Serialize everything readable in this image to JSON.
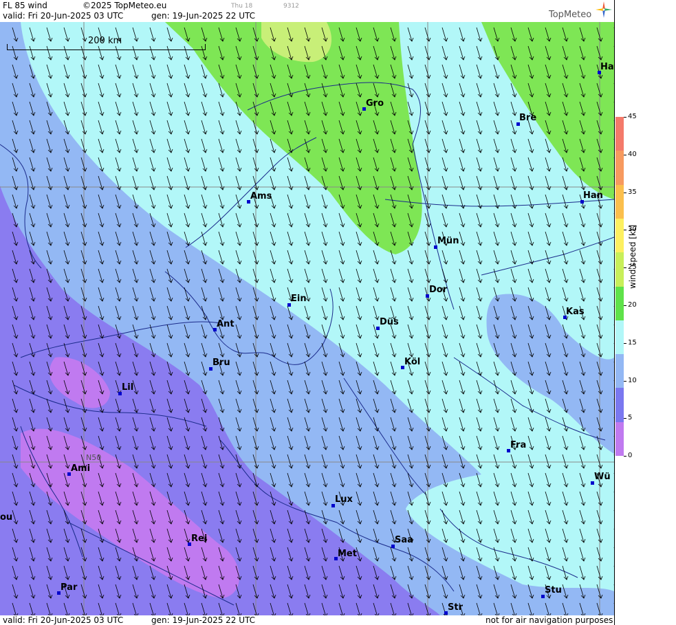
{
  "header": {
    "product": "FL 85 wind",
    "copyright": "©2025 TopMeteo.eu",
    "valid": "valid:  Fri  20-Jun-2025  03 UTC",
    "gen": "gen: 19-Jun-2025 22 UTC",
    "thu": "Thu 18",
    "code": "9312",
    "logo": "TopMeteo"
  },
  "footer": {
    "valid": "valid:  Fri  20-Jun-2025  03 UTC",
    "gen": "gen: 19-Jun-2025 22 UTC",
    "disclaimer": "not for air navigation purposes"
  },
  "map": {
    "scale_label": "200 km",
    "lat_label": "N50",
    "cities": [
      {
        "id": "ha",
        "label": "Ha"
      },
      {
        "id": "gro",
        "label": "Gro"
      },
      {
        "id": "bre",
        "label": "Bre"
      },
      {
        "id": "ams",
        "label": "Ams"
      },
      {
        "id": "han",
        "label": "Han"
      },
      {
        "id": "mun",
        "label": "Mün"
      },
      {
        "id": "dor",
        "label": "Dor"
      },
      {
        "id": "ein",
        "label": "Ein"
      },
      {
        "id": "kas",
        "label": "Kas"
      },
      {
        "id": "dus",
        "label": "Düs"
      },
      {
        "id": "ant",
        "label": "Ant"
      },
      {
        "id": "bru",
        "label": "Bru"
      },
      {
        "id": "kol",
        "label": "Köl"
      },
      {
        "id": "lil",
        "label": "Lil"
      },
      {
        "id": "fra",
        "label": "Fra"
      },
      {
        "id": "ami",
        "label": "Ami"
      },
      {
        "id": "wu",
        "label": "Wü"
      },
      {
        "id": "lux",
        "label": "Lux"
      },
      {
        "id": "ou",
        "label": "ou"
      },
      {
        "id": "rei",
        "label": "Rei"
      },
      {
        "id": "saa",
        "label": "Saa"
      },
      {
        "id": "met",
        "label": "Met"
      },
      {
        "id": "stu",
        "label": "Stu"
      },
      {
        "id": "par",
        "label": "Par"
      },
      {
        "id": "str",
        "label": "Str"
      }
    ]
  },
  "legend": {
    "title": "wind  speed  [kt]",
    "ticks": [
      "45",
      "40",
      "35",
      "30",
      "25",
      "20",
      "15",
      "10",
      "5",
      "0"
    ],
    "colors": [
      "#f47a6a",
      "#f79a5f",
      "#fbbf4d",
      "#fdf060",
      "#c8ef5a",
      "#5fe24a",
      "#b2f7f8",
      "#93b8f4",
      "#7a78f0",
      "#c07af0"
    ]
  },
  "colors": {
    "band_0_5": "#c07af0",
    "band_5_10": "#8a7cf0",
    "band_10_15": "#93b8f4",
    "band_15_20": "#b2f7f8",
    "band_20_25": "#7ee655",
    "band_25_30": "#c8ef78"
  }
}
